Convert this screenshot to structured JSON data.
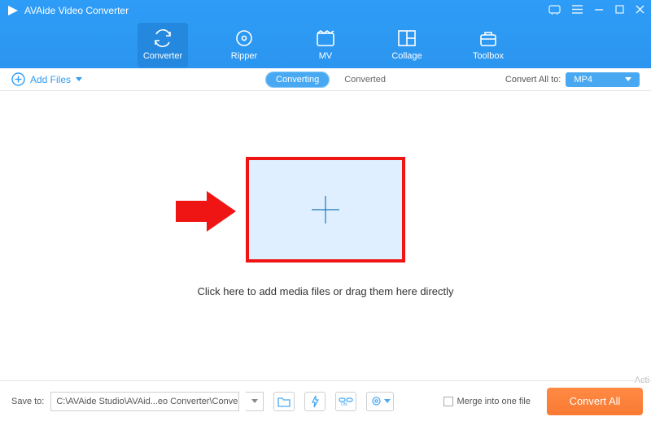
{
  "app": {
    "title": "AVAide Video Converter"
  },
  "nav": {
    "items": [
      {
        "label": "Converter"
      },
      {
        "label": "Ripper"
      },
      {
        "label": "MV"
      },
      {
        "label": "Collage"
      },
      {
        "label": "Toolbox"
      }
    ]
  },
  "toolbar": {
    "add_files": "Add Files",
    "tab_converting": "Converting",
    "tab_converted": "Converted",
    "convert_all_label": "Convert All to:",
    "format_selected": "MP4"
  },
  "drop": {
    "hint": "Click here to add media files or drag them here directly"
  },
  "footer": {
    "save_to_label": "Save to:",
    "save_path": "C:\\AVAide Studio\\AVAid...eo Converter\\Converted",
    "merge_label": "Merge into one file",
    "convert_button": "Convert All"
  },
  "watermark": "Acti"
}
